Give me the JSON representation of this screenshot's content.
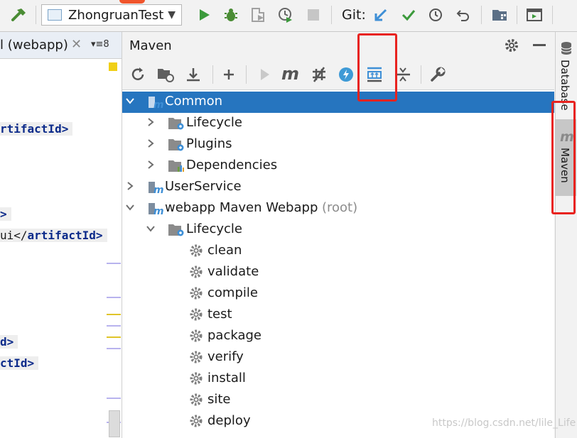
{
  "toolbar": {
    "run_config": "ZhongruanTest",
    "git_label": "Git:",
    "icons": [
      "hammer-icon",
      "run-icon",
      "debug-icon",
      "coverage-icon",
      "profile-icon",
      "stop-icon",
      "update-icon",
      "commit-icon",
      "history-icon",
      "rollback-icon",
      "project-structure-icon",
      "run-anything-icon"
    ]
  },
  "editor": {
    "tab_label": "l (webapp)",
    "tab_close": "✕",
    "tab_count": "▾≡8",
    "lines": [
      {
        "text": "rtifactId",
        "suffix": ">"
      },
      {
        "text": ">",
        "suffix": ""
      },
      {
        "text": "ui</",
        "suffix": "artifactId>"
      },
      {
        "text": "d>",
        "suffix": ""
      },
      {
        "text": "ctId>",
        "suffix": ""
      }
    ]
  },
  "maven": {
    "title": "Maven",
    "toolbar_icons": [
      "reload-icon",
      "reimport-folder-icon",
      "download-icon",
      "add-icon",
      "run-maven-icon",
      "maven-m-icon",
      "toggle-offline-icon",
      "skip-tests-icon",
      "show-dependencies-icon",
      "collapse-all-icon",
      "settings-wrench-icon"
    ],
    "tree": [
      {
        "label": "Common",
        "suffix": "",
        "level": 0,
        "chevron": "down",
        "icon": "maven-module-icon",
        "selected": true
      },
      {
        "label": "Lifecycle",
        "suffix": "",
        "level": 1,
        "chevron": "right",
        "icon": "lifecycle-folder-icon"
      },
      {
        "label": "Plugins",
        "suffix": "",
        "level": 1,
        "chevron": "right",
        "icon": "plugins-folder-icon"
      },
      {
        "label": "Dependencies",
        "suffix": "",
        "level": 1,
        "chevron": "right",
        "icon": "dependencies-folder-icon"
      },
      {
        "label": "UserService",
        "suffix": "",
        "level": 0,
        "chevron": "right",
        "icon": "maven-module-icon"
      },
      {
        "label": "webapp Maven Webapp",
        "suffix": "(root)",
        "level": 0,
        "chevron": "down",
        "icon": "maven-module-icon"
      },
      {
        "label": "Lifecycle",
        "suffix": "",
        "level": 1,
        "chevron": "down",
        "icon": "lifecycle-folder-icon"
      },
      {
        "label": "clean",
        "suffix": "",
        "level": 2,
        "chevron": "",
        "icon": "gear-icon"
      },
      {
        "label": "validate",
        "suffix": "",
        "level": 2,
        "chevron": "",
        "icon": "gear-icon"
      },
      {
        "label": "compile",
        "suffix": "",
        "level": 2,
        "chevron": "",
        "icon": "gear-icon"
      },
      {
        "label": "test",
        "suffix": "",
        "level": 2,
        "chevron": "",
        "icon": "gear-icon"
      },
      {
        "label": "package",
        "suffix": "",
        "level": 2,
        "chevron": "",
        "icon": "gear-icon"
      },
      {
        "label": "verify",
        "suffix": "",
        "level": 2,
        "chevron": "",
        "icon": "gear-icon"
      },
      {
        "label": "install",
        "suffix": "",
        "level": 2,
        "chevron": "",
        "icon": "gear-icon"
      },
      {
        "label": "site",
        "suffix": "",
        "level": 2,
        "chevron": "",
        "icon": "gear-icon"
      },
      {
        "label": "deploy",
        "suffix": "",
        "level": 2,
        "chevron": "",
        "icon": "gear-icon"
      }
    ]
  },
  "right_bar": {
    "database_label": "Database",
    "maven_label": "Maven"
  },
  "watermark": "https://blog.csdn.net/lile_Life",
  "colors": {
    "selection": "#2675bf",
    "highlight_box": "#e8231f",
    "run_green": "#3c9a3c",
    "vcs_blue": "#3e8fd6"
  }
}
